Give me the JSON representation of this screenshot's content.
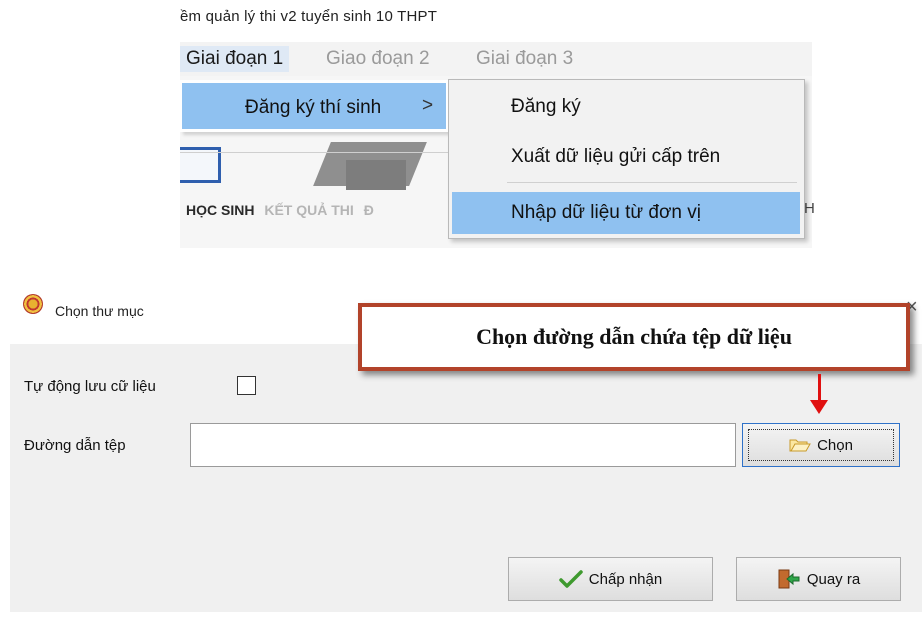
{
  "app": {
    "title_fragment": "ềm quản lý thi v2 tuyển sinh 10 THPT",
    "menu": [
      "Giai đoạn 1",
      "Giao đoạn 2",
      "Giai đoạn 3"
    ],
    "submenu_level1": {
      "label": "Đăng ký thí sinh",
      "arrow": ">"
    },
    "submenu_level2": [
      "Đăng ký",
      "Xuất dữ liệu gửi cấp trên",
      "Nhập dữ liệu từ đơn vị"
    ],
    "bottom_tabs": [
      "HỌC SINH",
      "KẾT QUẢ THI",
      "Đ"
    ],
    "right_fragment": "H"
  },
  "dialog": {
    "title": "Chọn thư mục",
    "close_glyph": "×",
    "auto_save_label": "Tự động lưu cữ liệu",
    "auto_save_checked": false,
    "path_label": "Đường dẫn tệp",
    "path_value": "",
    "browse_button": "Chọn",
    "accept_button": "Chấp nhận",
    "exit_button": "Quay ra"
  },
  "callout": {
    "text": "Chọn đường dẫn chứa tệp dữ liệu"
  },
  "colors": {
    "highlight": "#8fc1f0",
    "callout_border": "#b2432a",
    "arrow": "#e01010",
    "focus_border": "#2e71c8"
  }
}
